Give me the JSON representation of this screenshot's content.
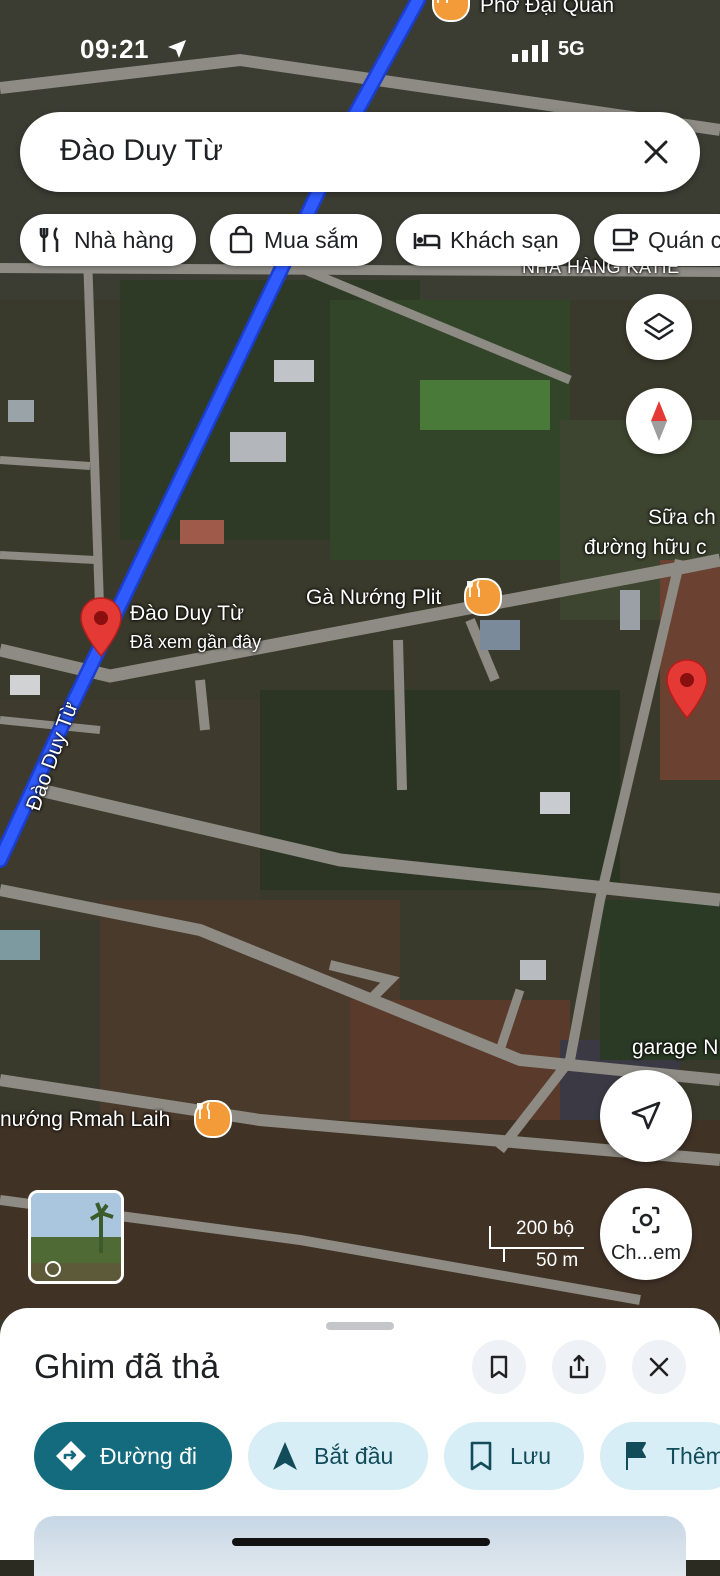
{
  "status_bar": {
    "time": "09:21",
    "network": "5G"
  },
  "search": {
    "query": "Đào Duy Từ"
  },
  "chips": [
    {
      "label": "Nhà hàng",
      "icon": "restaurant-icon"
    },
    {
      "label": "Mua sắm",
      "icon": "shopping-bag-icon"
    },
    {
      "label": "Khách sạn",
      "icon": "hotel-bed-icon"
    },
    {
      "label": "Quán c",
      "icon": "coffee-cup-icon"
    }
  ],
  "map_labels": {
    "top_place": "Phở Đại Quân",
    "restaurant_katie": "NHÀ HÀNG KATIE",
    "sua_line1": "Sữa ch",
    "sua_line2": "đường hữu c",
    "ga_nuong": "Gà Nướng Plit",
    "pin_title": "Đào Duy Từ",
    "pin_subtitle": "Đã xem gần đây",
    "road_name": "Đào Duy Từ",
    "rmah": "nướng Rmah Laih",
    "garage": "garage N"
  },
  "scale": {
    "imperial": "200 bộ",
    "metric": "50 m"
  },
  "lens": {
    "label": "Ch...em"
  },
  "sheet": {
    "title": "Ghim đã thả",
    "actions": [
      {
        "label": "Đường đi",
        "icon": "directions-icon"
      },
      {
        "label": "Bắt đầu",
        "icon": "navigation-arrow-icon"
      },
      {
        "label": "Lưu",
        "icon": "bookmark-icon"
      },
      {
        "label": "Thêm",
        "icon": "flag-icon"
      }
    ]
  },
  "colors": {
    "route_blue": "#2f5bff",
    "primary_action": "#146b7d",
    "secondary_action": "#d7eef6",
    "pin_red": "#e53935",
    "poi_orange": "#f29b38"
  }
}
